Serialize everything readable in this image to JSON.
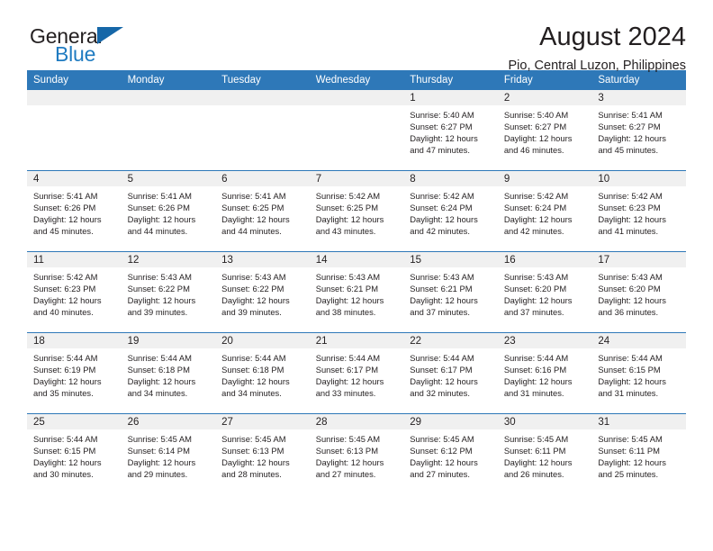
{
  "brand": {
    "name_top": "General",
    "name_bottom": "Blue",
    "triangle_color": "#1667a8",
    "blue_color": "#1f7bc1"
  },
  "header": {
    "title": "August 2024",
    "subtitle": "Pio, Central Luzon, Philippines"
  },
  "theme": {
    "header_blue": "#2e78b8",
    "daynum_band": "#f0f0f0",
    "text": "#231f20"
  },
  "weekdays": [
    "Sunday",
    "Monday",
    "Tuesday",
    "Wednesday",
    "Thursday",
    "Friday",
    "Saturday"
  ],
  "weeks": [
    [
      {
        "day": "",
        "lines": []
      },
      {
        "day": "",
        "lines": []
      },
      {
        "day": "",
        "lines": []
      },
      {
        "day": "",
        "lines": []
      },
      {
        "day": "1",
        "lines": [
          "Sunrise: 5:40 AM",
          "Sunset: 6:27 PM",
          "Daylight: 12 hours",
          "and 47 minutes."
        ]
      },
      {
        "day": "2",
        "lines": [
          "Sunrise: 5:40 AM",
          "Sunset: 6:27 PM",
          "Daylight: 12 hours",
          "and 46 minutes."
        ]
      },
      {
        "day": "3",
        "lines": [
          "Sunrise: 5:41 AM",
          "Sunset: 6:27 PM",
          "Daylight: 12 hours",
          "and 45 minutes."
        ]
      }
    ],
    [
      {
        "day": "4",
        "lines": [
          "Sunrise: 5:41 AM",
          "Sunset: 6:26 PM",
          "Daylight: 12 hours",
          "and 45 minutes."
        ]
      },
      {
        "day": "5",
        "lines": [
          "Sunrise: 5:41 AM",
          "Sunset: 6:26 PM",
          "Daylight: 12 hours",
          "and 44 minutes."
        ]
      },
      {
        "day": "6",
        "lines": [
          "Sunrise: 5:41 AM",
          "Sunset: 6:25 PM",
          "Daylight: 12 hours",
          "and 44 minutes."
        ]
      },
      {
        "day": "7",
        "lines": [
          "Sunrise: 5:42 AM",
          "Sunset: 6:25 PM",
          "Daylight: 12 hours",
          "and 43 minutes."
        ]
      },
      {
        "day": "8",
        "lines": [
          "Sunrise: 5:42 AM",
          "Sunset: 6:24 PM",
          "Daylight: 12 hours",
          "and 42 minutes."
        ]
      },
      {
        "day": "9",
        "lines": [
          "Sunrise: 5:42 AM",
          "Sunset: 6:24 PM",
          "Daylight: 12 hours",
          "and 42 minutes."
        ]
      },
      {
        "day": "10",
        "lines": [
          "Sunrise: 5:42 AM",
          "Sunset: 6:23 PM",
          "Daylight: 12 hours",
          "and 41 minutes."
        ]
      }
    ],
    [
      {
        "day": "11",
        "lines": [
          "Sunrise: 5:42 AM",
          "Sunset: 6:23 PM",
          "Daylight: 12 hours",
          "and 40 minutes."
        ]
      },
      {
        "day": "12",
        "lines": [
          "Sunrise: 5:43 AM",
          "Sunset: 6:22 PM",
          "Daylight: 12 hours",
          "and 39 minutes."
        ]
      },
      {
        "day": "13",
        "lines": [
          "Sunrise: 5:43 AM",
          "Sunset: 6:22 PM",
          "Daylight: 12 hours",
          "and 39 minutes."
        ]
      },
      {
        "day": "14",
        "lines": [
          "Sunrise: 5:43 AM",
          "Sunset: 6:21 PM",
          "Daylight: 12 hours",
          "and 38 minutes."
        ]
      },
      {
        "day": "15",
        "lines": [
          "Sunrise: 5:43 AM",
          "Sunset: 6:21 PM",
          "Daylight: 12 hours",
          "and 37 minutes."
        ]
      },
      {
        "day": "16",
        "lines": [
          "Sunrise: 5:43 AM",
          "Sunset: 6:20 PM",
          "Daylight: 12 hours",
          "and 37 minutes."
        ]
      },
      {
        "day": "17",
        "lines": [
          "Sunrise: 5:43 AM",
          "Sunset: 6:20 PM",
          "Daylight: 12 hours",
          "and 36 minutes."
        ]
      }
    ],
    [
      {
        "day": "18",
        "lines": [
          "Sunrise: 5:44 AM",
          "Sunset: 6:19 PM",
          "Daylight: 12 hours",
          "and 35 minutes."
        ]
      },
      {
        "day": "19",
        "lines": [
          "Sunrise: 5:44 AM",
          "Sunset: 6:18 PM",
          "Daylight: 12 hours",
          "and 34 minutes."
        ]
      },
      {
        "day": "20",
        "lines": [
          "Sunrise: 5:44 AM",
          "Sunset: 6:18 PM",
          "Daylight: 12 hours",
          "and 34 minutes."
        ]
      },
      {
        "day": "21",
        "lines": [
          "Sunrise: 5:44 AM",
          "Sunset: 6:17 PM",
          "Daylight: 12 hours",
          "and 33 minutes."
        ]
      },
      {
        "day": "22",
        "lines": [
          "Sunrise: 5:44 AM",
          "Sunset: 6:17 PM",
          "Daylight: 12 hours",
          "and 32 minutes."
        ]
      },
      {
        "day": "23",
        "lines": [
          "Sunrise: 5:44 AM",
          "Sunset: 6:16 PM",
          "Daylight: 12 hours",
          "and 31 minutes."
        ]
      },
      {
        "day": "24",
        "lines": [
          "Sunrise: 5:44 AM",
          "Sunset: 6:15 PM",
          "Daylight: 12 hours",
          "and 31 minutes."
        ]
      }
    ],
    [
      {
        "day": "25",
        "lines": [
          "Sunrise: 5:44 AM",
          "Sunset: 6:15 PM",
          "Daylight: 12 hours",
          "and 30 minutes."
        ]
      },
      {
        "day": "26",
        "lines": [
          "Sunrise: 5:45 AM",
          "Sunset: 6:14 PM",
          "Daylight: 12 hours",
          "and 29 minutes."
        ]
      },
      {
        "day": "27",
        "lines": [
          "Sunrise: 5:45 AM",
          "Sunset: 6:13 PM",
          "Daylight: 12 hours",
          "and 28 minutes."
        ]
      },
      {
        "day": "28",
        "lines": [
          "Sunrise: 5:45 AM",
          "Sunset: 6:13 PM",
          "Daylight: 12 hours",
          "and 27 minutes."
        ]
      },
      {
        "day": "29",
        "lines": [
          "Sunrise: 5:45 AM",
          "Sunset: 6:12 PM",
          "Daylight: 12 hours",
          "and 27 minutes."
        ]
      },
      {
        "day": "30",
        "lines": [
          "Sunrise: 5:45 AM",
          "Sunset: 6:11 PM",
          "Daylight: 12 hours",
          "and 26 minutes."
        ]
      },
      {
        "day": "31",
        "lines": [
          "Sunrise: 5:45 AM",
          "Sunset: 6:11 PM",
          "Daylight: 12 hours",
          "and 25 minutes."
        ]
      }
    ]
  ]
}
